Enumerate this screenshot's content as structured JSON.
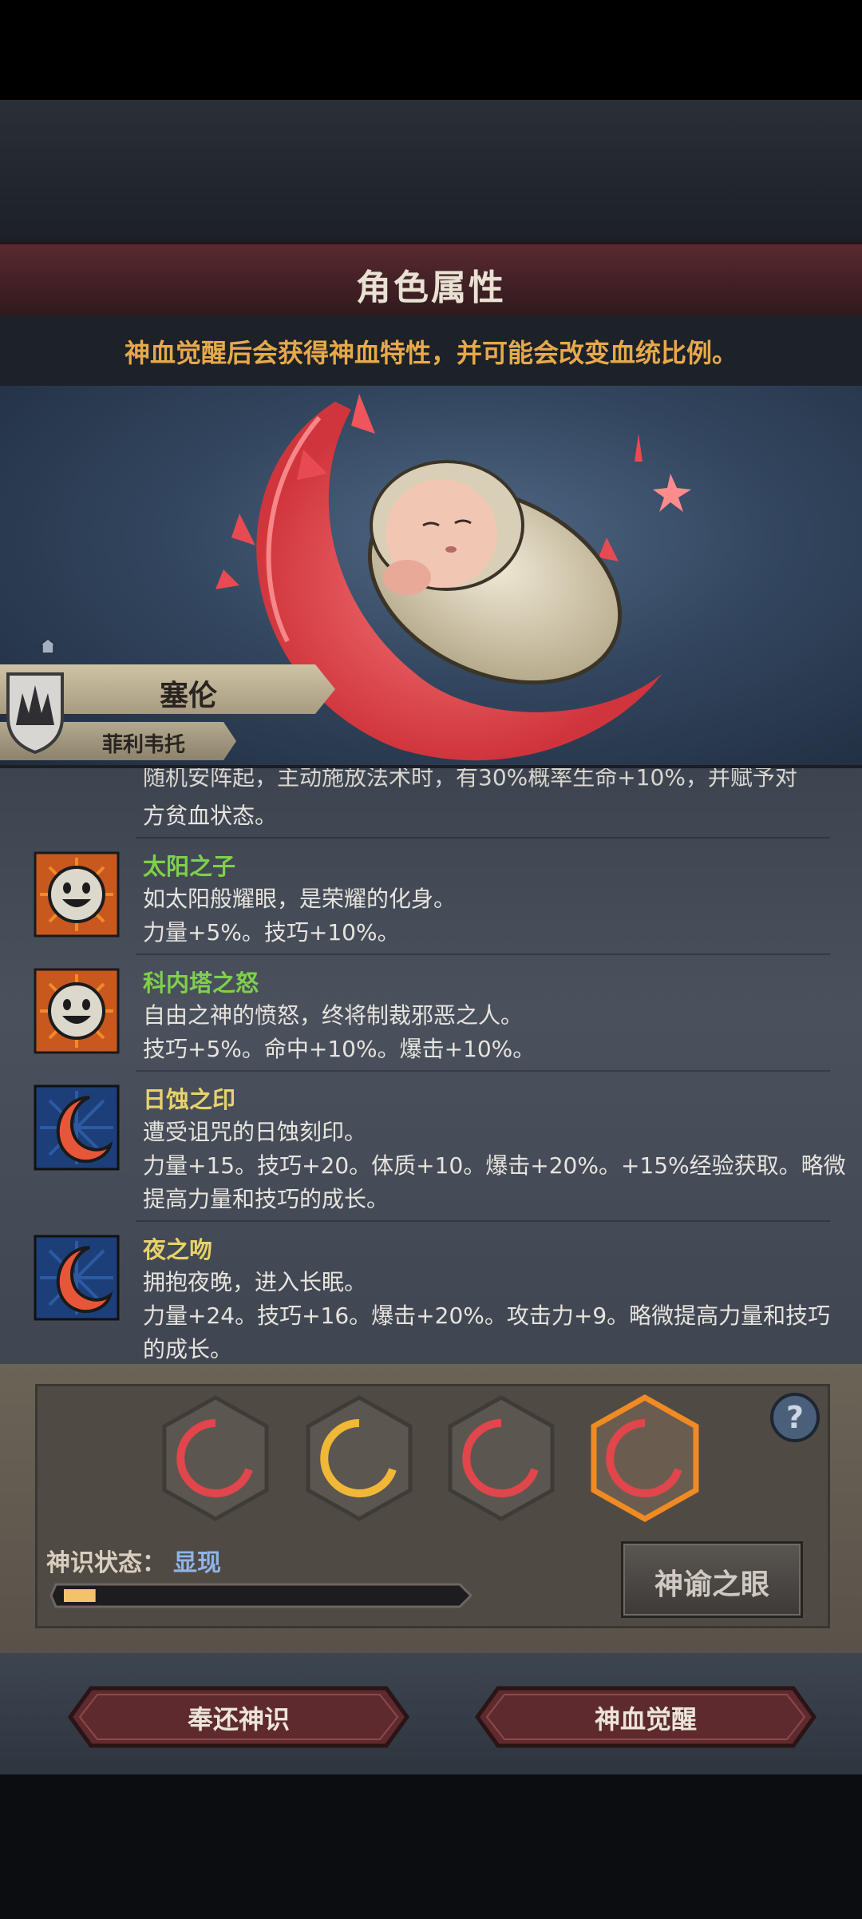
{
  "header": {
    "title": "角色属性",
    "subtitle": "神血觉醒后会获得神血特性，并可能会改变血统比例。"
  },
  "character": {
    "name": "塞伦",
    "title": "菲利韦托"
  },
  "traits": {
    "partial_line_1": "随机安阵起，主动施放法术时，有30%概率生命+10%，并赋予对",
    "partial_line_2": "方贫血状态。",
    "items": [
      {
        "name": "太阳之子",
        "name_color": "#7fd04a",
        "icon": "sun-face-icon",
        "desc": "如太阳般耀眼，是荣耀的化身。",
        "effect": "力量+5%。技巧+10%。",
        "effect2": ""
      },
      {
        "name": "科内塔之怒",
        "name_color": "#7fd04a",
        "icon": "sun-face-icon",
        "desc": "自由之神的愤怒，终将制裁邪恶之人。",
        "effect": "技巧+5%。命中+10%。爆击+10%。",
        "effect2": ""
      },
      {
        "name": "日蚀之印",
        "name_color": "#e7d36a",
        "icon": "crescent-moon-icon",
        "desc": "遭受诅咒的日蚀刻印。",
        "effect": "力量+15。技巧+20。体质+10。爆击+20%。+15%经验获取。略微",
        "effect2": "提高力量和技巧的成长。"
      },
      {
        "name": "夜之吻",
        "name_color": "#e7d36a",
        "icon": "crescent-moon-icon",
        "desc": "拥抱夜晚，进入长眠。",
        "effect": "力量+24。技巧+16。爆击+20%。攻击力+9。略微提高力量和技巧",
        "effect2": "的成长。"
      }
    ]
  },
  "divine": {
    "status_label": "神识状态：",
    "status_value": "显现",
    "progress": 0.08,
    "eye_button": "神谕之眼",
    "help": "?",
    "slots": [
      "red",
      "gold",
      "red",
      "red-selected"
    ]
  },
  "actions": {
    "return_label": "奉还神识",
    "awaken_label": "神血觉醒"
  },
  "colors": {
    "accent_orange": "#e6a94b",
    "trait_green": "#7fd04a",
    "trait_yellow": "#e7d36a",
    "status_blue": "#8fb4e8"
  }
}
